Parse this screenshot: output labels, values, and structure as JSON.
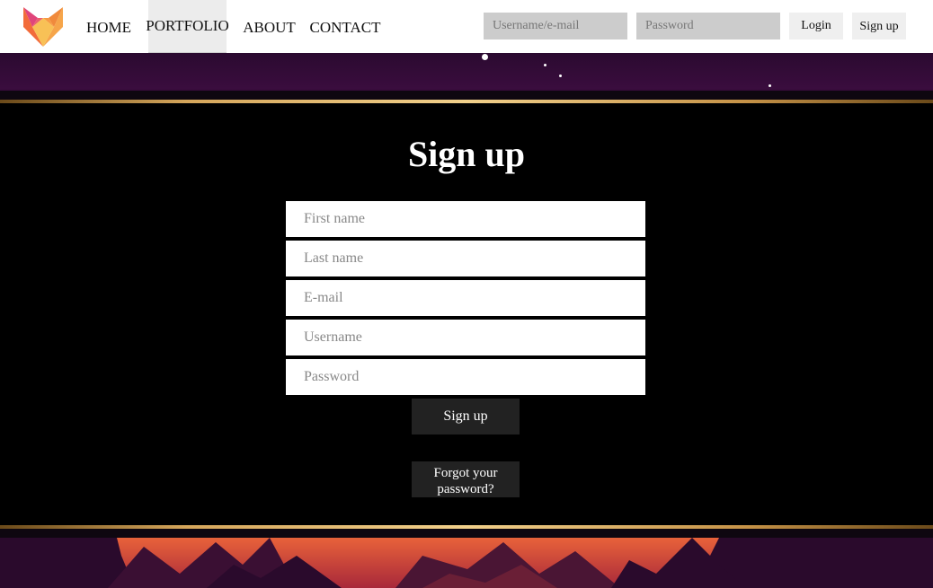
{
  "nav": {
    "home": "HOME",
    "portfolio": "PORTFOLIO",
    "about": "ABOUT",
    "contact": "CONTACT"
  },
  "header_login": {
    "username_placeholder": "Username/e-mail",
    "password_placeholder": "Password",
    "login_label": "Login",
    "signup_label": "Sign up"
  },
  "signup_form": {
    "title": "Sign up",
    "first_name_placeholder": "First name",
    "last_name_placeholder": "Last name",
    "email_placeholder": "E-mail",
    "username_placeholder": "Username",
    "password_placeholder": "Password",
    "submit_label": "Sign up",
    "forgot_label": "Forgot your password?"
  },
  "colors": {
    "accent_gold": "#d5a65b",
    "background_purple": "#2a0a2c",
    "panel_black": "#000000",
    "logo_orange": "#f08a3c",
    "logo_pink": "#e0457b"
  },
  "icons": {
    "logo": "fox-logo-icon"
  }
}
